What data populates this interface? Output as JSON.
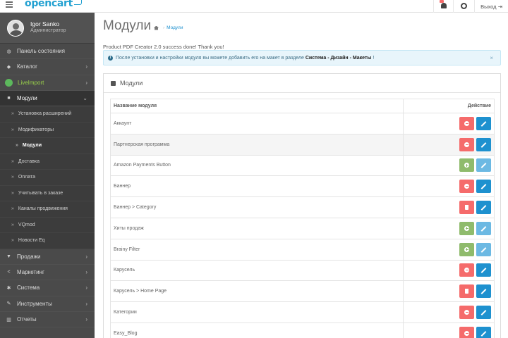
{
  "header": {
    "logo": "opencart",
    "logout": "Выход"
  },
  "profile": {
    "name": "Igor Sanko",
    "role": "Администратор"
  },
  "sidebar": {
    "items_top": [
      {
        "label": "Панель состояния",
        "icon": "dashboard-icon",
        "has_chevron": false
      },
      {
        "label": "Каталог",
        "icon": "tag-icon",
        "has_chevron": true
      },
      {
        "label": "LiveImport",
        "icon": "liveimport-icon",
        "has_chevron": true
      }
    ],
    "modules": {
      "label": "Модули",
      "icon": "puzzle-icon"
    },
    "sub_items": [
      {
        "label": "Установка расширений"
      },
      {
        "label": "Модификаторы"
      },
      {
        "label": "Модули"
      },
      {
        "label": "Доставка"
      },
      {
        "label": "Оплата"
      },
      {
        "label": "Учитывать в заказе"
      },
      {
        "label": "Каналы продвижения"
      },
      {
        "label": "VQmod"
      },
      {
        "label": "Новости Eq"
      }
    ],
    "items_bottom": [
      {
        "label": "Продажи",
        "icon": "cart-icon"
      },
      {
        "label": "Маркетинг",
        "icon": "share-icon"
      },
      {
        "label": "Система",
        "icon": "cog-icon"
      },
      {
        "label": "Инструменты",
        "icon": "wrench-icon"
      },
      {
        "label": "Отчеты",
        "icon": "bar-chart-icon"
      }
    ]
  },
  "main": {
    "title": "Модули",
    "breadcrumb": "Модули",
    "success_text": "Product PDF Creator 2.0 success done! Thank you!",
    "alert": {
      "before": "После установки и настройки модуля вы можете добавить его на макет в разделе",
      "path": "Система - Дизайн - Макеты",
      "after": "!",
      "close": "×"
    },
    "panel_title": "Модули",
    "table": {
      "col_name": "Название модуля",
      "col_action": "Действие",
      "rows": [
        {
          "name": "Аккаунт",
          "first": "uninstall",
          "second": "edit"
        },
        {
          "name": "Партнерская программа",
          "first": "uninstall",
          "second": "edit"
        },
        {
          "name": "Amazon Payments Button",
          "first": "install",
          "second": "edit-disabled"
        },
        {
          "name": "Баннер",
          "first": "uninstall",
          "second": "edit"
        },
        {
          "name": "Баннер > Category",
          "first": "delete",
          "second": "edit"
        },
        {
          "name": "Хиты продаж",
          "first": "install",
          "second": "edit-disabled"
        },
        {
          "name": "Brainy Filter",
          "first": "install",
          "second": "edit-disabled"
        },
        {
          "name": "Карусель",
          "first": "uninstall",
          "second": "edit"
        },
        {
          "name": "Карусель > Home Page",
          "first": "delete",
          "second": "edit"
        },
        {
          "name": "Категории",
          "first": "uninstall",
          "second": "edit"
        },
        {
          "name": "Easy_Blog",
          "first": "uninstall",
          "second": "edit"
        }
      ]
    }
  }
}
